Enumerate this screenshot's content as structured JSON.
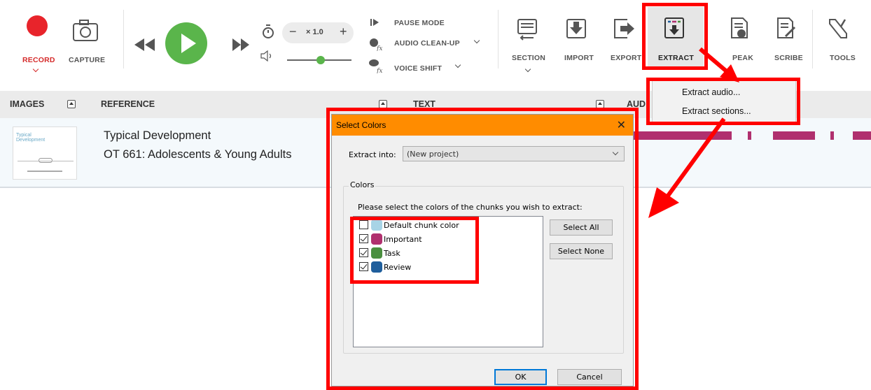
{
  "toolbar": {
    "record_label": "RECORD",
    "capture_label": "CAPTURE",
    "speed_value": "× 1.0",
    "pause_mode_label": "PAUSE MODE",
    "audio_cleanup_label": "AUDIO CLEAN-UP",
    "voice_shift_label": "VOICE SHIFT",
    "section_label": "SECTION",
    "import_label": "IMPORT",
    "export_label": "EXPORT",
    "extract_label": "EXTRACT",
    "speak_label": "PEAK",
    "scribe_label": "SCRIBE",
    "tools_label": "TOOLS",
    "colors": {
      "record": "#e8242b",
      "play": "#5ab54b"
    }
  },
  "columns": {
    "images": "IMAGES",
    "reference": "REFERENCE",
    "text": "TEXT",
    "audio": "AUD"
  },
  "row": {
    "thumb_title": "Typical Development",
    "title": "Typical Development",
    "subtitle": "OT 661: Adolescents & Young Adults"
  },
  "extract_menu": {
    "items": [
      "Extract audio...",
      "Extract sections..."
    ]
  },
  "dialog": {
    "title": "Select Colors",
    "close": "✕",
    "extract_into_label": "Extract into:",
    "extract_into_value": "(New project)",
    "colors_group": "Colors",
    "instruction": "Please select the colors of the chunks you wish to extract:",
    "items": [
      {
        "label": "Default chunk color",
        "checked": false,
        "color": "#a8d4e6"
      },
      {
        "label": "Important",
        "checked": true,
        "color": "#b0306e"
      },
      {
        "label": "Task",
        "checked": true,
        "color": "#4a8f3f"
      },
      {
        "label": "Review",
        "checked": true,
        "color": "#1f5e9c"
      }
    ],
    "select_all": "Select All",
    "select_none": "Select None",
    "ok": "OK",
    "cancel": "Cancel"
  }
}
